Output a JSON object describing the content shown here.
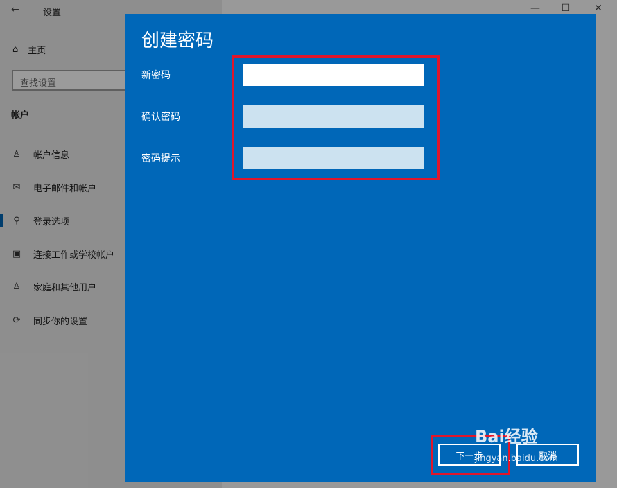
{
  "window": {
    "title": "设置",
    "back_icon": "arrow-left-icon",
    "controls": {
      "minimize": "—",
      "maximize": "☐",
      "close": "✕"
    }
  },
  "sidebar": {
    "home_label": "主页",
    "search_placeholder": "查找设置",
    "section_title": "帐户",
    "items": [
      {
        "label": "帐户信息",
        "icon": "person-card-icon"
      },
      {
        "label": "电子邮件和帐户",
        "icon": "mail-icon"
      },
      {
        "label": "登录选项",
        "icon": "key-icon",
        "active": true
      },
      {
        "label": "连接工作或学校帐户",
        "icon": "briefcase-icon"
      },
      {
        "label": "家庭和其他用户",
        "icon": "person-add-icon"
      },
      {
        "label": "同步你的设置",
        "icon": "sync-icon"
      }
    ]
  },
  "dialog": {
    "title": "创建密码",
    "fields": [
      {
        "label": "新密码",
        "value": ""
      },
      {
        "label": "确认密码",
        "value": ""
      },
      {
        "label": "密码提示",
        "value": ""
      }
    ],
    "next_button": "下一步",
    "cancel_button": "取消"
  },
  "watermark": {
    "top": "Bai经验",
    "bottom": "jingyan.baidu.com"
  },
  "colors": {
    "dialog_bg": "#0067b8",
    "highlight": "#e0162b",
    "field_inactive": "#cce2f0"
  }
}
